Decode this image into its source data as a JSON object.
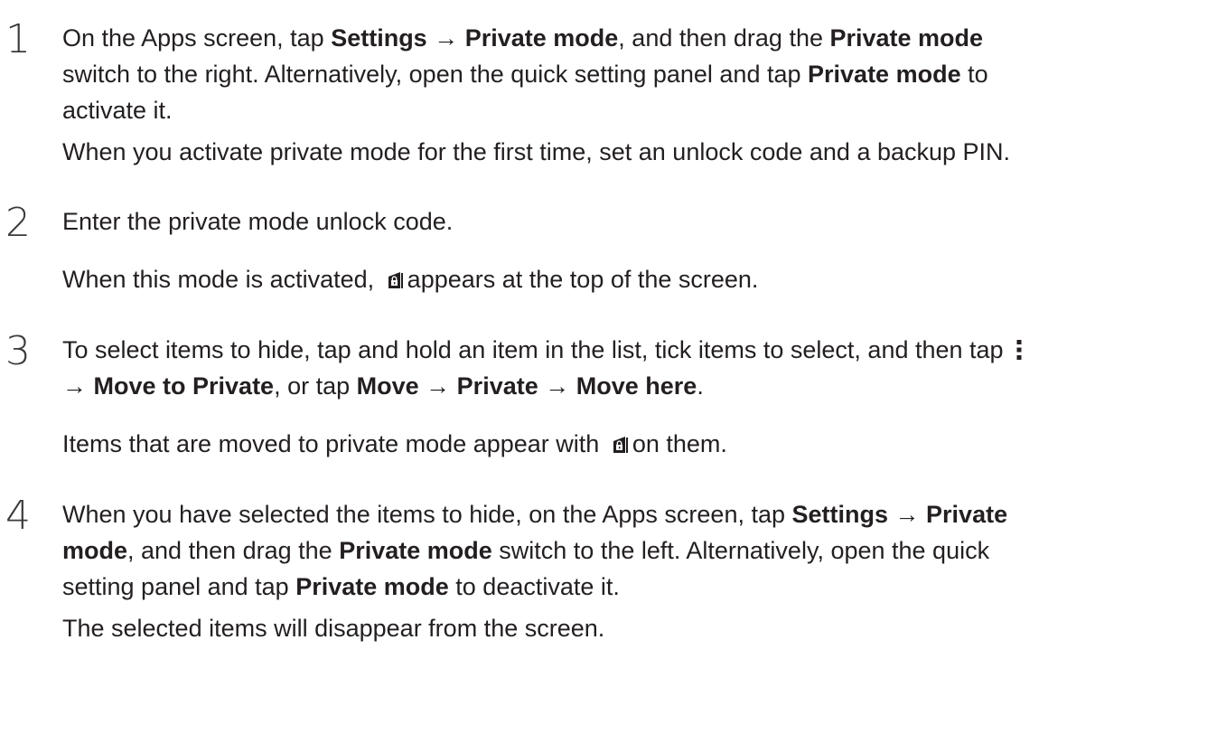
{
  "steps": [
    {
      "number": "1",
      "lines": [
        [
          {
            "t": "On the Apps screen, tap "
          },
          {
            "t": "Settings",
            "b": true
          },
          {
            "t": " → "
          },
          {
            "t": "Private mode",
            "b": true
          },
          {
            "t": ", and then drag the "
          },
          {
            "t": "Private mode",
            "b": true
          }
        ],
        [
          {
            "t": "switch to the right. Alternatively, open the quick setting panel and tap "
          },
          {
            "t": "Private mode",
            "b": true
          },
          {
            "t": " to"
          }
        ],
        [
          {
            "t": "activate it."
          }
        ]
      ],
      "note": [
        [
          {
            "t": "When you activate private mode for the first time, set an unlock code and a backup PIN."
          }
        ]
      ]
    },
    {
      "number": "2",
      "lines": [
        [
          {
            "t": "Enter the private mode unlock code."
          }
        ]
      ],
      "note": [
        [
          {
            "t": "When this mode is activated, "
          },
          {
            "icon": "private-mode-lock-icon"
          },
          {
            "t": "appears at the top of the screen."
          }
        ]
      ]
    },
    {
      "number": "3",
      "lines": [
        [
          {
            "t": "To select items to hide, tap and hold an item in the list, tick items to select, and then tap "
          },
          {
            "icon": "more-options-icon"
          }
        ],
        [
          {
            "t": "→ "
          },
          {
            "t": "Move to Private",
            "b": true
          },
          {
            "t": ", or tap "
          },
          {
            "t": "Move",
            "b": true
          },
          {
            "t": " → "
          },
          {
            "t": "Private",
            "b": true
          },
          {
            "t": " → "
          },
          {
            "t": "Move here",
            "b": true
          },
          {
            "t": "."
          }
        ]
      ],
      "note": [
        [
          {
            "t": "Items that are moved to private mode appear with "
          },
          {
            "icon": "private-mode-lock-icon"
          },
          {
            "t": "on them."
          }
        ]
      ]
    },
    {
      "number": "4",
      "lines": [
        [
          {
            "t": "When you have selected the items to hide, on the Apps screen, tap "
          },
          {
            "t": "Settings",
            "b": true
          },
          {
            "t": " → "
          },
          {
            "t": "Private",
            "b": true
          }
        ],
        [
          {
            "t": "mode",
            "b": true
          },
          {
            "t": ", and then drag the "
          },
          {
            "t": "Private mode",
            "b": true
          },
          {
            "t": " switch to the left. Alternatively, open the quick"
          }
        ],
        [
          {
            "t": "setting panel and tap "
          },
          {
            "t": "Private mode",
            "b": true
          },
          {
            "t": " to deactivate it."
          }
        ]
      ],
      "note": [
        [
          {
            "t": "The selected items will disappear from the screen."
          }
        ]
      ]
    }
  ]
}
